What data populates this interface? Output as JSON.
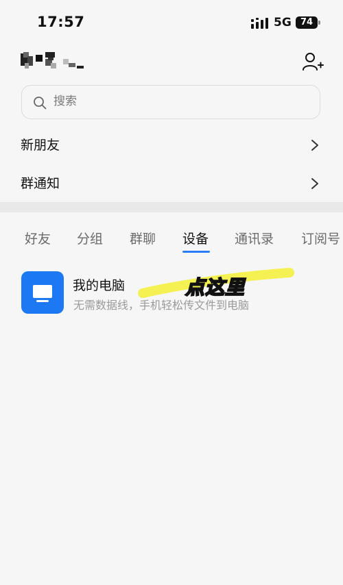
{
  "status_bar": {
    "time": "17:57",
    "network": "5G",
    "battery": "74"
  },
  "search": {
    "placeholder": "搜索"
  },
  "rows": {
    "new_friends": "新朋友",
    "group_notice": "群通知"
  },
  "tabs": [
    {
      "label": "好友"
    },
    {
      "label": "分组"
    },
    {
      "label": "群聊"
    },
    {
      "label": "设备"
    },
    {
      "label": "通讯录"
    },
    {
      "label": "订阅号"
    }
  ],
  "device": {
    "title": "我的电脑",
    "subtitle": "无需数据线，手机轻松传文件到电脑"
  },
  "annotation": {
    "text": "点这里",
    "highlight_color": "#f4f04a"
  },
  "colors": {
    "accent": "#2b7cf6",
    "device_icon_bg": "#1d78f3"
  },
  "icons": {
    "search": "search-icon",
    "add_friend": "add-friend-icon",
    "chevron": "chevron-right-icon",
    "computer": "computer-icon"
  }
}
